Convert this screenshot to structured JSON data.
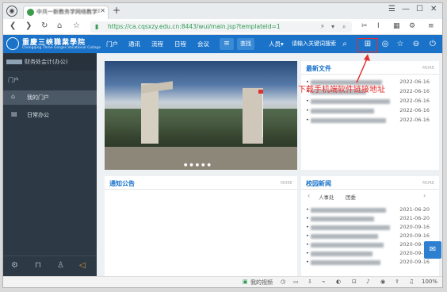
{
  "browser": {
    "tab_title": "中共一新教务学网络教学平台(新系统)",
    "new_tab": "+",
    "url": "https://ca.cqsxzy.edu.cn:8443/wui/main.jsp?templateId=1",
    "window_controls": [
      "☰",
      "—",
      "☐",
      "✕"
    ]
  },
  "site": {
    "logo_cn": "重慶三峽職業學院",
    "logo_en": "Chongqing Three Gorges Vocational College",
    "nav": [
      "门户",
      "通讯",
      "流程",
      "日程",
      "会议"
    ],
    "find_label": "查找",
    "search_select": "人员",
    "search_placeholder": "请输入关键词搜索",
    "annotation": "下载手机端软件链接地址"
  },
  "sidebar": {
    "user_label": "财务处会计(办公)",
    "section": "门户",
    "items": [
      {
        "label": "我的门户",
        "icon": "home-icon"
      },
      {
        "label": "日常办公",
        "icon": "doc-icon"
      }
    ],
    "bottom_icons": [
      "settings-icon",
      "lock-icon",
      "shirt-icon",
      "speaker-icon"
    ]
  },
  "panels": {
    "latest_docs": {
      "title": "最新文件",
      "more": "MORE",
      "rows": [
        {
          "date": "2022-06-16"
        },
        {
          "date": "2022-06-16"
        },
        {
          "date": "2022-06-16"
        },
        {
          "date": "2022-06-16"
        },
        {
          "date": "2022-06-16"
        }
      ]
    },
    "notices": {
      "title": "通知公告",
      "more": "MORE"
    },
    "campus_news": {
      "title": "校园新闻",
      "more": "MORE",
      "tabs": [
        "人事处",
        "团委"
      ],
      "rows": [
        {
          "date": "2021-06-20"
        },
        {
          "date": "2021-06-20"
        },
        {
          "date": "2020-09-16"
        },
        {
          "date": "2020-09-16"
        },
        {
          "date": "2020-09-16"
        },
        {
          "date": "2020-09-16"
        },
        {
          "date": "2020-09-16"
        }
      ]
    }
  },
  "statusbar": {
    "left_label": "我的视频",
    "zoom": "100%"
  },
  "colors": {
    "header_blue": "#1a73c9",
    "sidebar_dark": "#2d3a46",
    "annotation_red": "#e52d2d"
  }
}
